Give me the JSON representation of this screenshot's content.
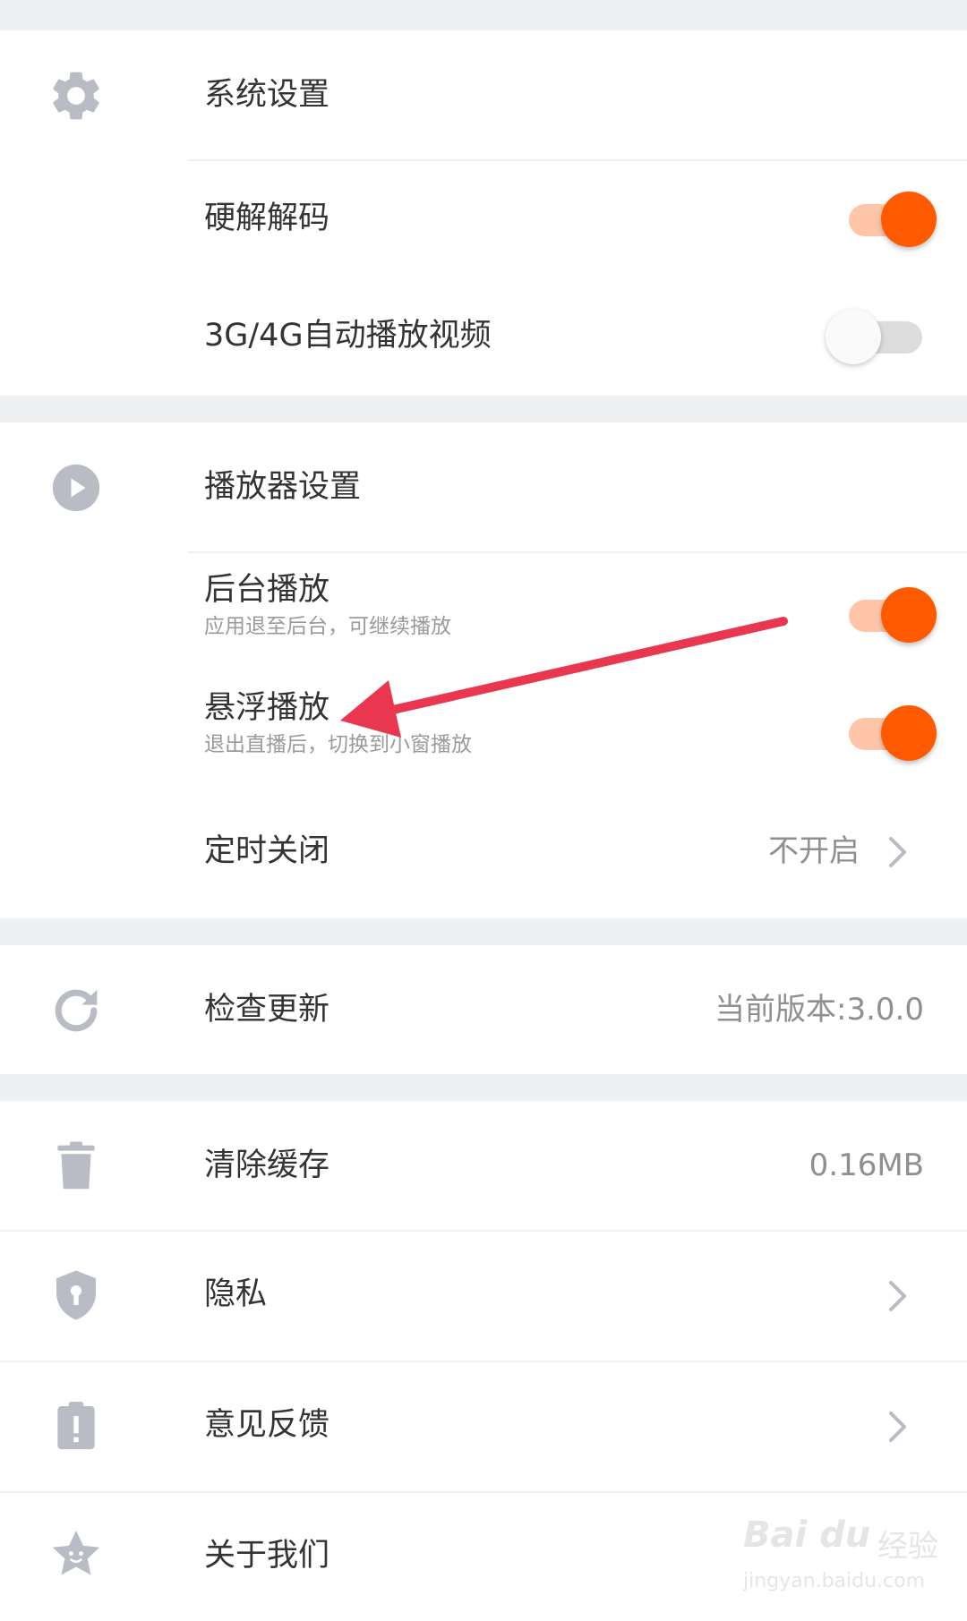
{
  "system": {
    "title": "系统设置",
    "icon": "gear-icon",
    "hardware_decoding": {
      "label": "硬解解码",
      "enabled": true
    },
    "autoplay_mobile": {
      "label": "3G/4G自动播放视频",
      "enabled": false
    }
  },
  "player": {
    "title": "播放器设置",
    "icon": "play-circle-icon",
    "background_play": {
      "label": "后台播放",
      "sub": "应用退至后台，可继续播放",
      "enabled": true
    },
    "floating_play": {
      "label": "悬浮播放",
      "sub": "退出直播后，切换到小窗播放",
      "enabled": true
    },
    "sleep_timer": {
      "label": "定时关闭",
      "value": "不开启"
    }
  },
  "update": {
    "label": "检查更新",
    "value": "当前版本:3.0.0",
    "icon": "refresh-icon"
  },
  "cache": {
    "label": "清除缓存",
    "value": "0.16MB",
    "icon": "trash-icon"
  },
  "privacy": {
    "label": "隐私",
    "icon": "shield-icon"
  },
  "feedback": {
    "label": "意见反馈",
    "icon": "clipboard-alert-icon"
  },
  "about": {
    "label": "关于我们",
    "icon": "star-face-icon"
  },
  "watermark": {
    "logo": "Bai du",
    "text": "经验",
    "url": "jingyan.baidu.com"
  },
  "colors": {
    "accent": "#ff5a00",
    "accent_track": "#ffc5a8",
    "arrow": "#e8374f",
    "icon": "#b9bcc4",
    "background": "#eeeff1"
  }
}
